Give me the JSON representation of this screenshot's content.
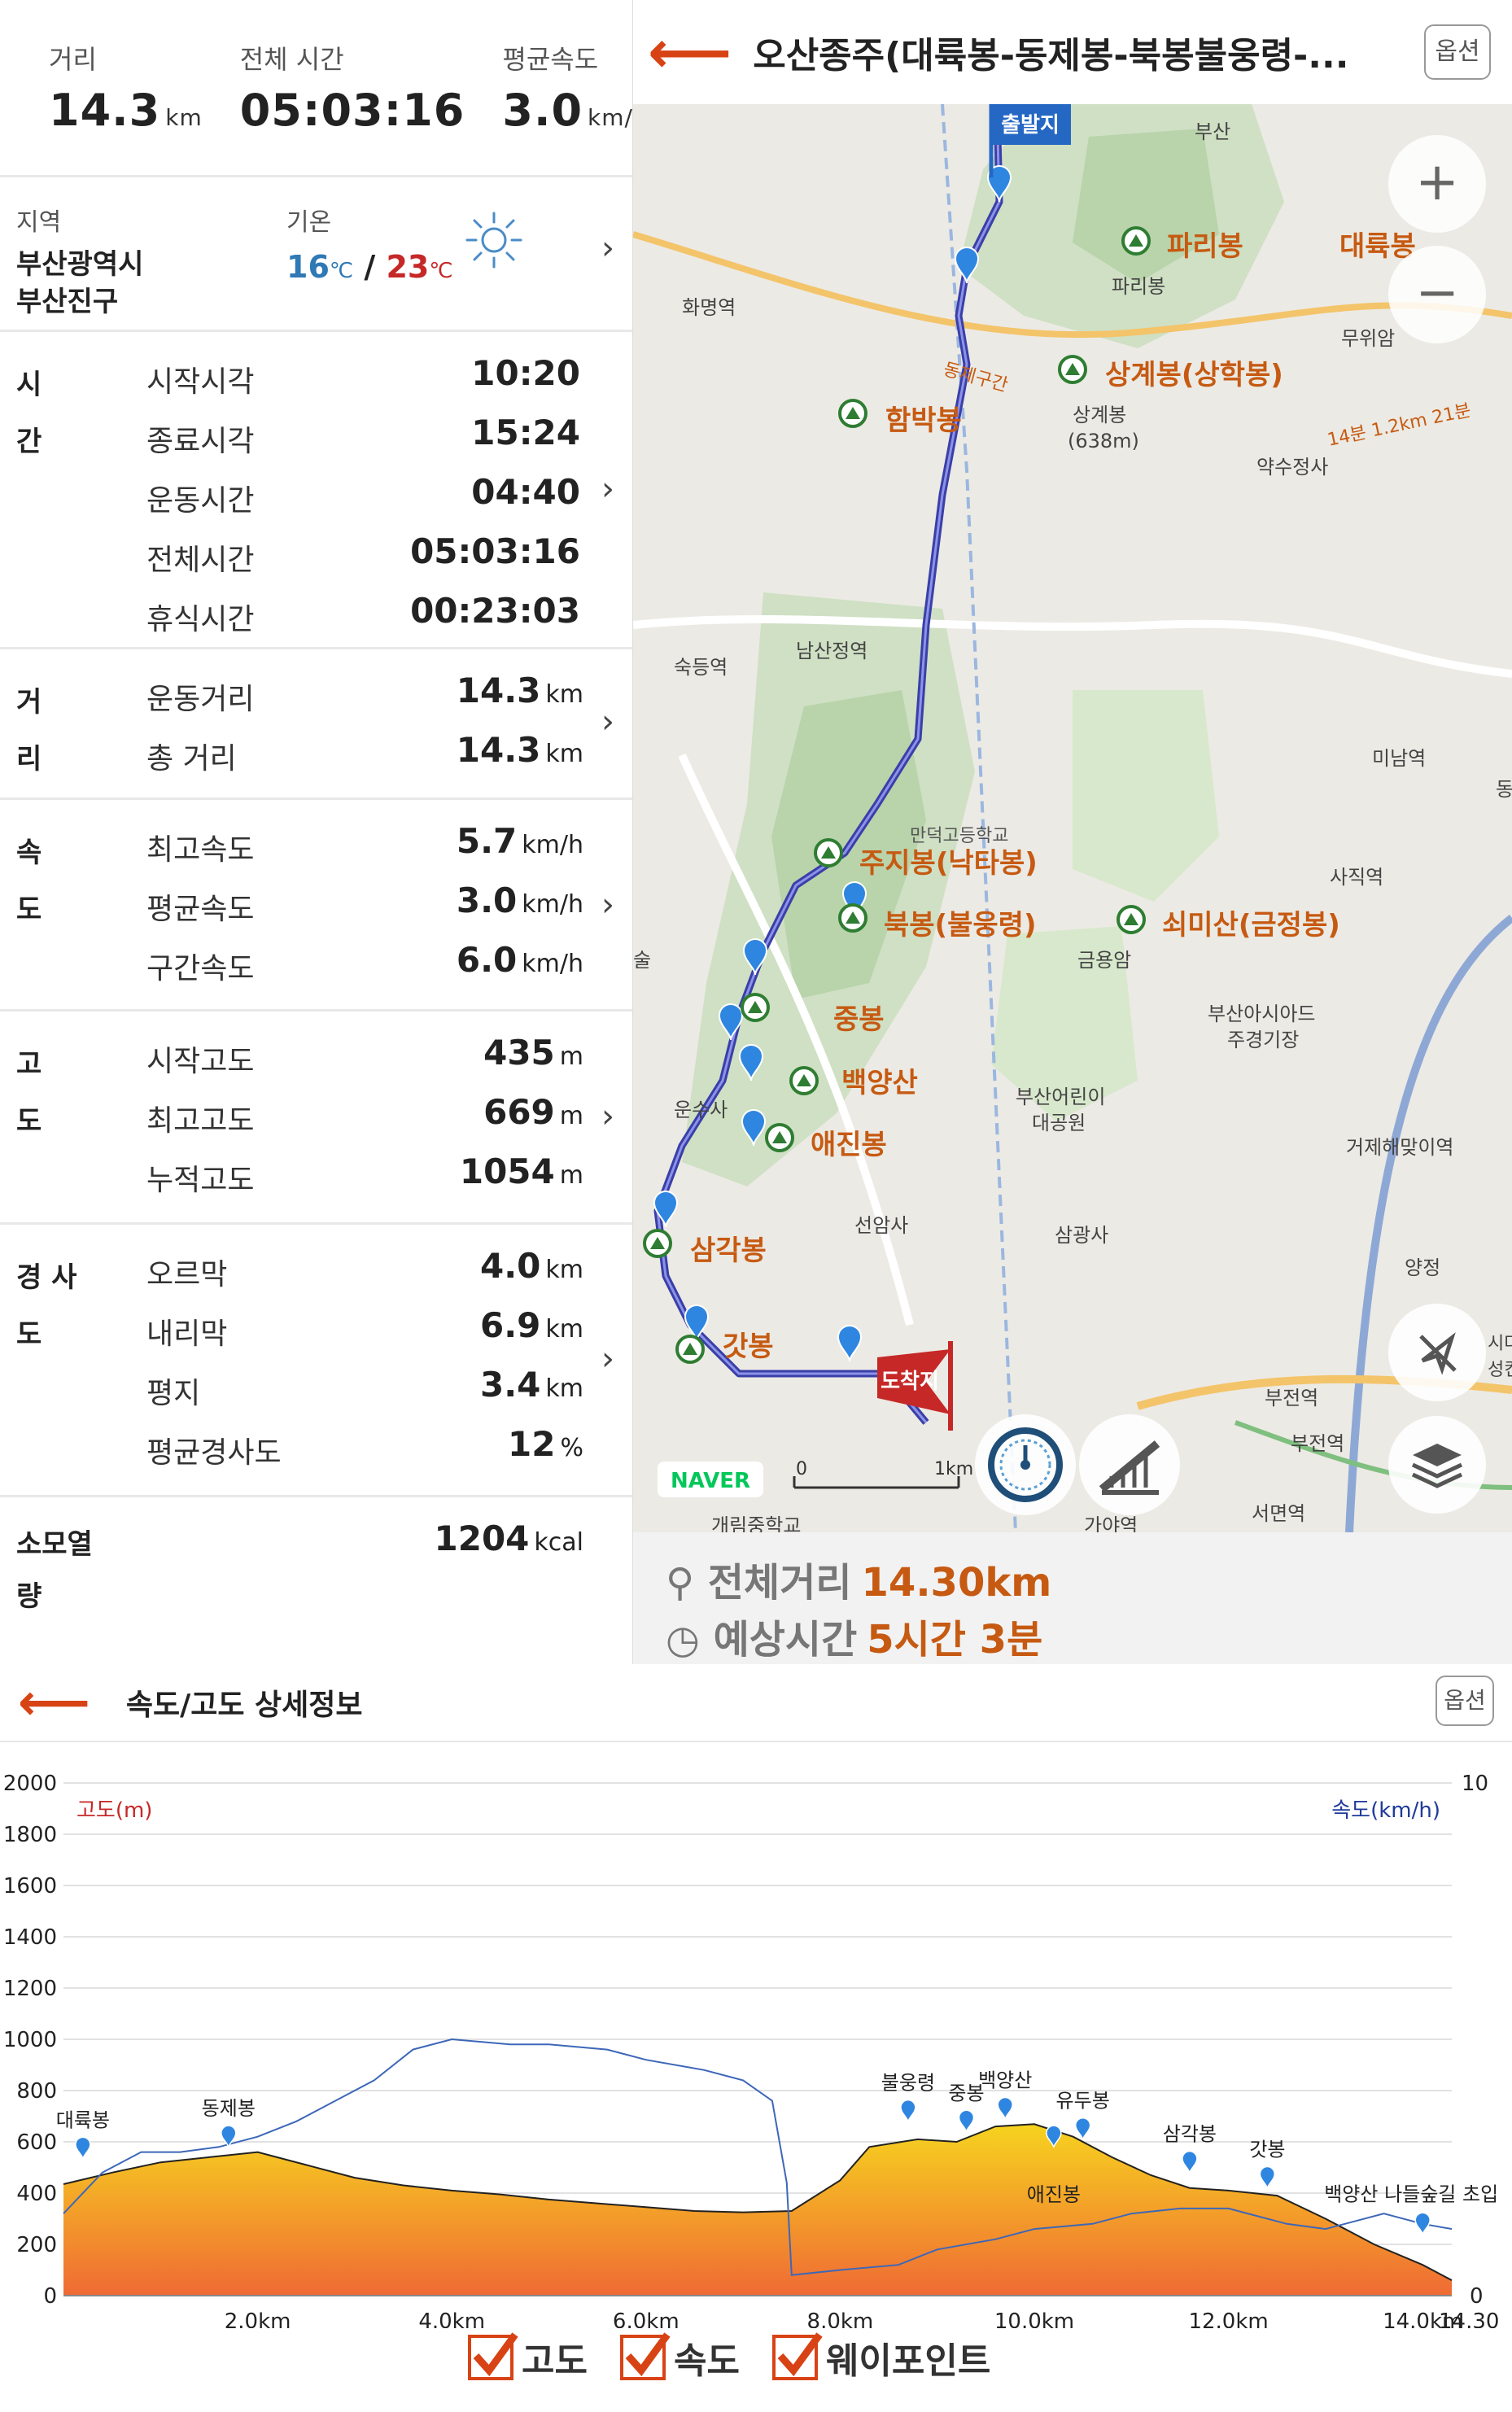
{
  "summary": {
    "distance": {
      "label": "거리",
      "value": "14.3",
      "unit": "km"
    },
    "total_time": {
      "label": "전체 시간",
      "value": "05:03:16"
    },
    "avg_speed": {
      "label": "평균속도",
      "value": "3.0",
      "unit": "km/h"
    }
  },
  "region": {
    "label": "지역",
    "line1": "부산광역시",
    "line2": "부산진구",
    "temp_label": "기온",
    "temp_low": "16",
    "temp_high": "23",
    "temp_unit": "℃",
    "sep": "/",
    "weather_icon": "sun-icon"
  },
  "groups": {
    "time": {
      "label_1": "시",
      "label_2": "간",
      "rows": [
        {
          "label": "시작시각",
          "value": "10:20"
        },
        {
          "label": "종료시각",
          "value": "15:24"
        },
        {
          "label": "운동시간",
          "value": "04:40"
        },
        {
          "label": "전체시간",
          "value": "05:03:16"
        },
        {
          "label": "휴식시간",
          "value": "00:23:03"
        }
      ]
    },
    "distance": {
      "label_1": "거",
      "label_2": "리",
      "rows": [
        {
          "label": "운동거리",
          "value": "14.3",
          "unit": "km"
        },
        {
          "label": "총 거리",
          "value": "14.3",
          "unit": "km"
        }
      ]
    },
    "speed": {
      "label_1": "속",
      "label_2": "도",
      "rows": [
        {
          "label": "최고속도",
          "value": "5.7",
          "unit": "km/h"
        },
        {
          "label": "평균속도",
          "value": "3.0",
          "unit": "km/h"
        },
        {
          "label": "구간속도",
          "value": "6.0",
          "unit": "km/h"
        }
      ]
    },
    "altitude": {
      "label_1": "고",
      "label_2": "도",
      "rows": [
        {
          "label": "시작고도",
          "value": "435",
          "unit": "m"
        },
        {
          "label": "최고고도",
          "value": "669",
          "unit": "m"
        },
        {
          "label": "누적고도",
          "value": "1054",
          "unit": "m"
        }
      ]
    },
    "slope": {
      "label_1": "경 사",
      "label_2": "도",
      "rows": [
        {
          "label": "오르막",
          "value": "4.0",
          "unit": "km"
        },
        {
          "label": "내리막",
          "value": "6.9",
          "unit": "km"
        },
        {
          "label": "평지",
          "value": "3.4",
          "unit": "km"
        },
        {
          "label": "평균경사도",
          "value": "12",
          "unit": "%"
        }
      ]
    },
    "calories": {
      "label_1": "소모열",
      "label_2": "량",
      "value": "1204",
      "unit": "kcal"
    }
  },
  "map": {
    "title": "오산종주(대륙봉-동제봉-북봉불웅령-...",
    "option_label": "옵션",
    "zoom_in": "+",
    "zoom_out": "−",
    "scale_0": "0",
    "scale_1": "1km",
    "brand": "NAVER",
    "start_flag": "출발지",
    "end_flag": "도착지",
    "footer_distance_label": "전체거리",
    "footer_distance_value": "14.30km",
    "footer_time_label": "예상시간",
    "footer_time_value": "5시간 3분",
    "labels": [
      {
        "text": "파리봉",
        "kind": "peak"
      },
      {
        "text": "파리봉",
        "kind": "small"
      },
      {
        "text": "대륙봉",
        "kind": "peak"
      },
      {
        "text": "무위암",
        "kind": "small"
      },
      {
        "text": "상계봉(상학봉)",
        "kind": "peak"
      },
      {
        "text": "상계봉",
        "kind": "small"
      },
      {
        "text": "(638m)",
        "kind": "small"
      },
      {
        "text": "함박봉",
        "kind": "peak"
      },
      {
        "text": "화명역",
        "kind": "small"
      },
      {
        "text": "약수정사",
        "kind": "small"
      },
      {
        "text": "14분 1.2km 21분",
        "kind": "route"
      },
      {
        "text": "동제구간",
        "kind": "route"
      },
      {
        "text": "부산",
        "kind": "small"
      },
      {
        "text": "숙등역",
        "kind": "small"
      },
      {
        "text": "남산정역",
        "kind": "small"
      },
      {
        "text": "미남역",
        "kind": "small"
      },
      {
        "text": "만덕고등학교",
        "kind": "small"
      },
      {
        "text": "주지봉(낙타봉)",
        "kind": "peak"
      },
      {
        "text": "북봉(불웅령)",
        "kind": "peak"
      },
      {
        "text": "쇠미산(금정봉)",
        "kind": "peak"
      },
      {
        "text": "사직역",
        "kind": "small"
      },
      {
        "text": "금용암",
        "kind": "small"
      },
      {
        "text": "부산아시아드",
        "kind": "small"
      },
      {
        "text": "주경기장",
        "kind": "small"
      },
      {
        "text": "중봉",
        "kind": "peak"
      },
      {
        "text": "백양산",
        "kind": "peak"
      },
      {
        "text": "부산어린이",
        "kind": "small"
      },
      {
        "text": "대공원",
        "kind": "small"
      },
      {
        "text": "운수사",
        "kind": "small"
      },
      {
        "text": "애진봉",
        "kind": "peak"
      },
      {
        "text": "거제해맞이역",
        "kind": "small"
      },
      {
        "text": "선암사",
        "kind": "small"
      },
      {
        "text": "삼광사",
        "kind": "small"
      },
      {
        "text": "삼각봉",
        "kind": "peak"
      },
      {
        "text": "양정",
        "kind": "small"
      },
      {
        "text": "갓봉",
        "kind": "peak"
      },
      {
        "text": "부전역",
        "kind": "small"
      },
      {
        "text": "부전역",
        "kind": "small"
      },
      {
        "text": "서면역",
        "kind": "small"
      },
      {
        "text": "가야역",
        "kind": "small"
      },
      {
        "text": "개림중학교",
        "kind": "small"
      },
      {
        "text": "동",
        "kind": "small"
      },
      {
        "text": "술",
        "kind": "small"
      },
      {
        "text": "시다",
        "kind": "small"
      },
      {
        "text": "성킨",
        "kind": "small"
      }
    ]
  },
  "elevation": {
    "title": "속도/고도 상세정보",
    "option_label": "옵션",
    "legend": [
      {
        "label": "고도",
        "checked": true
      },
      {
        "label": "속도",
        "checked": true
      },
      {
        "label": "웨이포인트",
        "checked": true
      }
    ],
    "chart_data": {
      "type": "area",
      "ylabel": "고도(m)",
      "y2label": "속도(km/h)",
      "ylim": [
        0,
        2000
      ],
      "y2lim": [
        0,
        10
      ],
      "yticks": [
        "2000",
        "1800",
        "1600",
        "1400",
        "1200",
        "1000",
        "800",
        "600",
        "400",
        "200",
        "0"
      ],
      "y2ticks": [
        "10",
        "0"
      ],
      "xticks": [
        "2.0km",
        "4.0km",
        "6.0km",
        "8.0km",
        "10.0km",
        "12.0km",
        "14.0km",
        "14.30"
      ],
      "xlim": [
        0,
        14.3
      ],
      "altitude": {
        "x": [
          0,
          0.5,
          1.0,
          1.5,
          2.0,
          2.5,
          3.0,
          3.5,
          4.0,
          4.5,
          5.0,
          5.5,
          6.0,
          6.5,
          7.0,
          7.5,
          8.0,
          8.3,
          8.8,
          9.2,
          9.6,
          10.0,
          10.4,
          10.8,
          11.2,
          11.6,
          12.0,
          12.5,
          13.0,
          13.5,
          14.0,
          14.3
        ],
        "y": [
          435,
          480,
          520,
          540,
          560,
          510,
          460,
          430,
          410,
          395,
          375,
          360,
          345,
          330,
          325,
          330,
          450,
          580,
          610,
          600,
          660,
          669,
          620,
          540,
          470,
          420,
          410,
          390,
          300,
          200,
          120,
          60
        ]
      },
      "speed": {
        "x": [
          0,
          0.4,
          0.8,
          1.2,
          1.6,
          2.0,
          2.4,
          2.8,
          3.2,
          3.6,
          4.0,
          4.6,
          5.0,
          5.6,
          6.0,
          6.6,
          7.0,
          7.3,
          7.45,
          7.5,
          8.0,
          8.6,
          9.0,
          9.6,
          10.0,
          10.6,
          11.0,
          11.5,
          12.0,
          12.6,
          13.0,
          13.6,
          14.0,
          14.3
        ],
        "y": [
          1.6,
          2.4,
          2.8,
          2.8,
          2.9,
          3.1,
          3.4,
          3.8,
          4.2,
          4.8,
          5.0,
          4.9,
          4.9,
          4.8,
          4.6,
          4.4,
          4.2,
          3.8,
          2.2,
          0.4,
          0.5,
          0.6,
          0.9,
          1.1,
          1.3,
          1.4,
          1.6,
          1.7,
          1.7,
          1.4,
          1.3,
          1.6,
          1.4,
          1.3
        ]
      },
      "waypoints": [
        {
          "name": "대륙봉",
          "x": 0.2,
          "y": 545
        },
        {
          "name": "동제봉",
          "x": 1.7,
          "y": 590
        },
        {
          "name": "불웅령",
          "x": 8.7,
          "y": 690
        },
        {
          "name": "중봉",
          "x": 9.3,
          "y": 650
        },
        {
          "name": "백양산",
          "x": 9.7,
          "y": 700
        },
        {
          "name": "애진봉",
          "x": 10.2,
          "y": 590
        },
        {
          "name": "유두봉",
          "x": 10.5,
          "y": 620
        },
        {
          "name": "삼각봉",
          "x": 11.6,
          "y": 490
        },
        {
          "name": "갓봉",
          "x": 12.4,
          "y": 430
        },
        {
          "name": "백양산 나들숲길 초입",
          "x": 14.0,
          "y": 250
        }
      ]
    }
  }
}
